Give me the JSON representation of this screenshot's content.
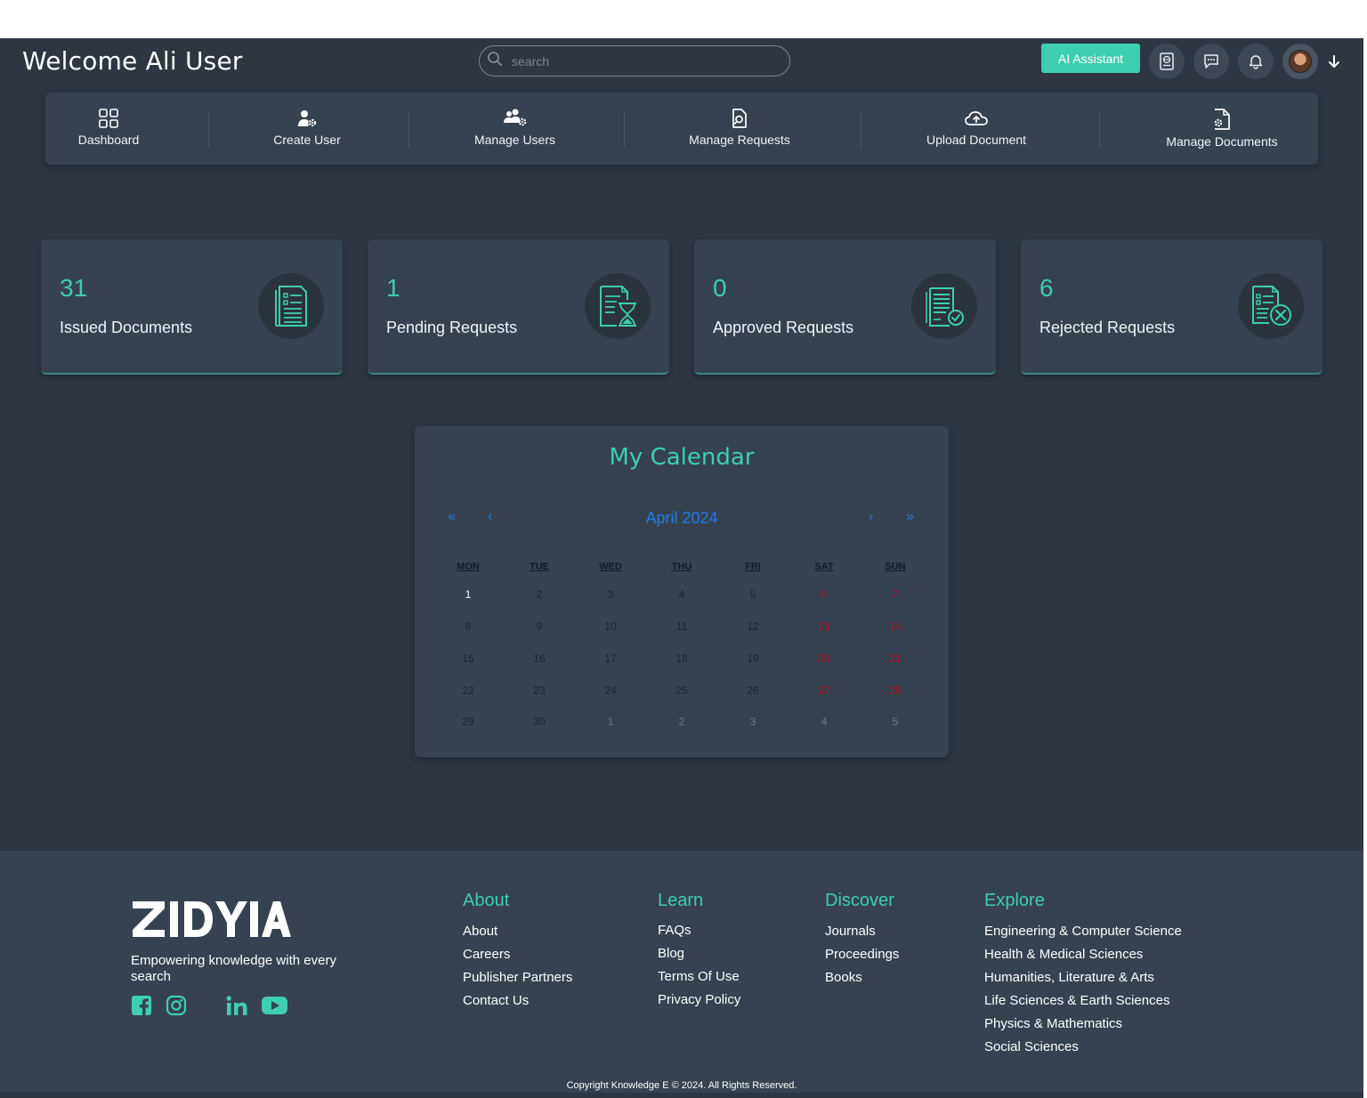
{
  "header": {
    "welcome": "Welcome Ali User",
    "search_placeholder": "search",
    "ai_assistant_label": "AI Assistant",
    "icons": [
      "passport-icon",
      "chat-icon",
      "bell-icon",
      "avatar",
      "arrow-down-icon"
    ]
  },
  "nav": {
    "items": [
      {
        "label": "Dashboard",
        "icon": "grid-icon"
      },
      {
        "label": "Create User",
        "icon": "user-gear-icon"
      },
      {
        "label": "Manage Users",
        "icon": "users-gear-icon"
      },
      {
        "label": "Manage Requests",
        "icon": "document-search-icon"
      },
      {
        "label": "Upload Document",
        "icon": "cloud-upload-icon"
      },
      {
        "label": "Manage Documents",
        "icon": "document-gear-icon"
      }
    ]
  },
  "stats": [
    {
      "value": "31",
      "label": "Issued Documents",
      "icon": "document-list-icon"
    },
    {
      "value": "1",
      "label": "Pending Requests",
      "icon": "document-hourglass-icon"
    },
    {
      "value": "0",
      "label": "Approved Requests",
      "icon": "document-check-icon"
    },
    {
      "value": "6",
      "label": "Rejected Requests",
      "icon": "document-reject-icon"
    }
  ],
  "calendar": {
    "title": "My Calendar",
    "month_label": "April 2024",
    "nav": {
      "prev_year": "«",
      "prev_month": "‹",
      "next_month": "›",
      "next_year": "»"
    },
    "weekdays": [
      "MON",
      "TUE",
      "WED",
      "THU",
      "FRI",
      "SAT",
      "SUN"
    ],
    "weeks": [
      [
        "1",
        "2",
        "3",
        "4",
        "5",
        "6",
        "7"
      ],
      [
        "8",
        "9",
        "10",
        "11",
        "12",
        "13",
        "14"
      ],
      [
        "15",
        "16",
        "17",
        "18",
        "19",
        "20",
        "21"
      ],
      [
        "22",
        "23",
        "24",
        "25",
        "26",
        "27",
        "28"
      ],
      [
        "29",
        "30",
        "1",
        "2",
        "3",
        "4",
        "5"
      ]
    ],
    "colors": {
      "weekday": "#1b232c",
      "weekend": "#b3141b",
      "other_month": "#6d7782",
      "today": "#ffffff",
      "nav": "#1f7ae8"
    }
  },
  "footer": {
    "logo_text": "ZIDYIA",
    "tagline": "Empowering knowledge with every search",
    "social": [
      "facebook-icon",
      "instagram-icon",
      "linkedin-icon",
      "youtube-icon"
    ],
    "columns": [
      {
        "title": "About",
        "links": [
          "About",
          "Careers",
          "Publisher Partners",
          "Contact Us"
        ]
      },
      {
        "title": "Learn",
        "links": [
          "FAQs",
          "Blog",
          "Terms Of Use",
          "Privacy Policy"
        ]
      },
      {
        "title": "Discover",
        "links": [
          "Journals",
          "Proceedings",
          "Books"
        ]
      },
      {
        "title": "Explore",
        "links": [
          "Engineering & Computer Science",
          "Health & Medical Sciences",
          "Humanities, Literature & Arts",
          "Life Sciences & Earth Sciences",
          "Physics & Mathematics",
          "Social Sciences"
        ]
      }
    ],
    "copyright": "Copyright Knowledge E © 2024. All Rights Reserved."
  },
  "theme": {
    "accent": "#3dcfae",
    "background": "#2d3641",
    "panel": "#36424f"
  }
}
